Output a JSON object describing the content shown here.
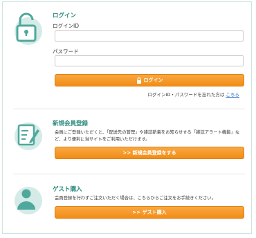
{
  "login": {
    "title": "ログイン",
    "id_label": "ログインID",
    "id_value": "",
    "password_label": "パスワード",
    "password_value": "",
    "button_label": "ログイン",
    "forgot_text": "ログインID・パスワードを忘れた方は",
    "forgot_link": "こちら"
  },
  "register": {
    "title": "新規会員登録",
    "description": "会員にご登録いただくと、「配送先の管理」や雑誌新着をお知らせする「雑誌アラート機能」など、より便利に当サイトをご利用いただけます。",
    "button_label": ">> 新規会員登録をする"
  },
  "guest": {
    "title": "ゲスト購入",
    "description": "会員登録を行わずご注文いただく場合は、こちらからご注文をお手続きください。",
    "button_label": ">> ゲスト購入"
  },
  "colors": {
    "accent": "#2e8b7e",
    "button": "#f28c16",
    "link": "#1a63c4",
    "icon_circle": "#d4ebe7",
    "icon_stroke": "#4fa89c"
  },
  "icons": [
    "lock-icon",
    "register-form-icon",
    "guest-person-icon",
    "button-lock-icon"
  ]
}
